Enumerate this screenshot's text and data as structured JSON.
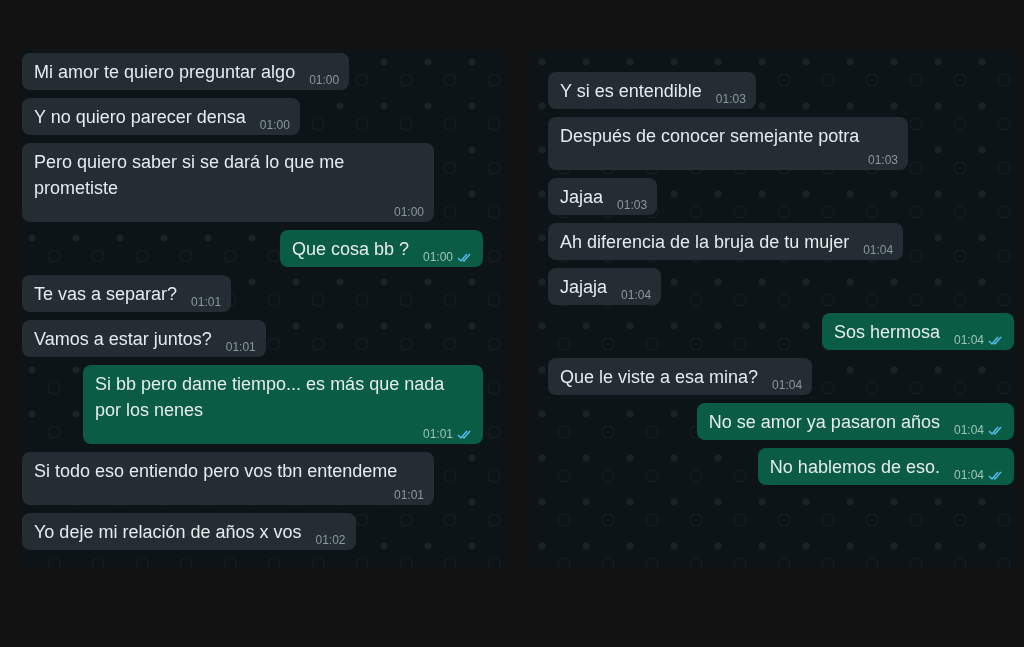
{
  "panels": [
    {
      "messages": [
        {
          "kind": "incoming",
          "text": "Mi amor te quiero preguntar algo",
          "time": "01:00"
        },
        {
          "kind": "incoming",
          "text": "Y no quiero parecer densa",
          "time": "01:00"
        },
        {
          "kind": "incoming",
          "text": "Pero quiero saber si se dará lo que me prometiste",
          "time": "01:00"
        },
        {
          "kind": "outgoing",
          "text": "Que cosa bb ?",
          "time": "01:00",
          "read": true
        },
        {
          "kind": "incoming",
          "text": "Te vas a separar?",
          "time": "01:01"
        },
        {
          "kind": "incoming",
          "text": "Vamos a estar juntos?",
          "time": "01:01"
        },
        {
          "kind": "outgoing",
          "text": "Si bb pero dame tiempo... es más que nada por los nenes",
          "time": "01:01",
          "read": true
        },
        {
          "kind": "incoming",
          "text": "Si todo eso entiendo pero vos tbn entendeme",
          "time": "01:01"
        },
        {
          "kind": "incoming",
          "text": "Yo deje mi relación de años x vos",
          "time": "01:02"
        }
      ]
    },
    {
      "messages": [
        {
          "kind": "incoming",
          "text": "Y si es entendible",
          "time": "01:03"
        },
        {
          "kind": "incoming",
          "text": "Después de conocer semejante potra",
          "time": "01:03"
        },
        {
          "kind": "incoming",
          "text": "Jajaa",
          "time": "01:03"
        },
        {
          "kind": "incoming",
          "text": "Ah diferencia de la bruja de tu mujer",
          "time": "01:04"
        },
        {
          "kind": "incoming",
          "text": "Jajaja",
          "time": "01:04"
        },
        {
          "kind": "outgoing",
          "text": "Sos hermosa",
          "time": "01:04",
          "read": true
        },
        {
          "kind": "incoming",
          "text": "Que le viste a esa mina?",
          "time": "01:04"
        },
        {
          "kind": "outgoing",
          "text": "No se amor ya pasaron años",
          "time": "01:04",
          "read": true
        },
        {
          "kind": "outgoing",
          "text": "No hablemos de eso.",
          "time": "01:04",
          "read": true
        }
      ]
    }
  ]
}
